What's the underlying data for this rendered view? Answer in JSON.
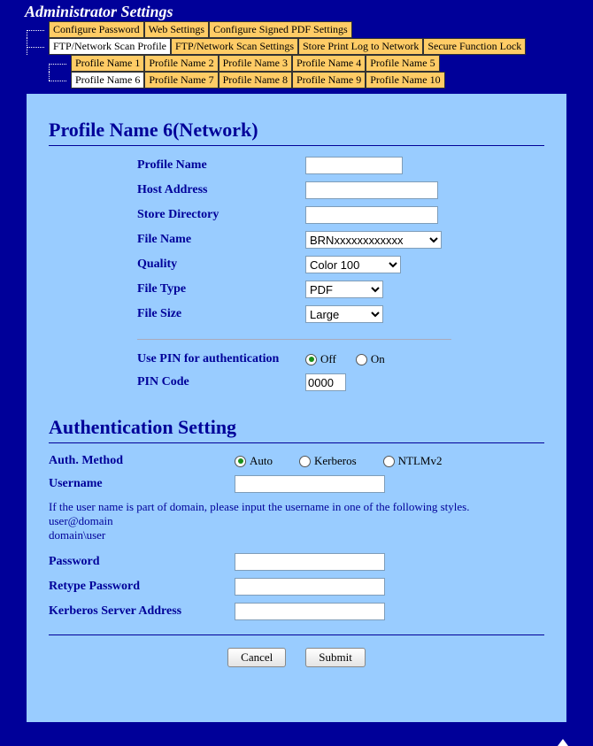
{
  "title": "Administrator Settings",
  "nav": {
    "row1": [
      {
        "label": "Configure Password",
        "active": false
      },
      {
        "label": "Web Settings",
        "active": false
      },
      {
        "label": "Configure Signed PDF Settings",
        "active": false
      }
    ],
    "row2": [
      {
        "label": "FTP/Network Scan Profile",
        "active": true
      },
      {
        "label": "FTP/Network Scan Settings",
        "active": false
      },
      {
        "label": "Store Print Log to Network",
        "active": false
      },
      {
        "label": "Secure Function Lock",
        "active": false
      }
    ],
    "row3": [
      {
        "label": "Profile Name 1",
        "active": false
      },
      {
        "label": "Profile Name 2",
        "active": false
      },
      {
        "label": "Profile Name 3",
        "active": false
      },
      {
        "label": "Profile Name 4",
        "active": false
      },
      {
        "label": "Profile Name 5",
        "active": false
      }
    ],
    "row4": [
      {
        "label": "Profile Name 6",
        "active": true
      },
      {
        "label": "Profile Name 7",
        "active": false
      },
      {
        "label": "Profile Name 8",
        "active": false
      },
      {
        "label": "Profile Name 9",
        "active": false
      },
      {
        "label": "Profile Name 10",
        "active": false
      }
    ]
  },
  "section1": {
    "heading": "Profile Name 6(Network)",
    "labels": {
      "profile_name": "Profile Name",
      "host_address": "Host Address",
      "store_directory": "Store Directory",
      "file_name": "File Name",
      "quality": "Quality",
      "file_type": "File Type",
      "file_size": "File Size",
      "use_pin": "Use PIN for authentication",
      "pin_code": "PIN Code"
    },
    "values": {
      "profile_name": "",
      "host_address": "",
      "store_directory": "",
      "file_name": "BRNxxxxxxxxxxxx",
      "quality": "Color 100",
      "file_type": "PDF",
      "file_size": "Large",
      "pin_off": "Off",
      "pin_on": "On",
      "pin_code": "0000"
    }
  },
  "section2": {
    "heading": "Authentication Setting",
    "labels": {
      "auth_method": "Auth. Method",
      "username": "Username",
      "password": "Password",
      "retype_password": "Retype Password",
      "kerberos": "Kerberos Server Address"
    },
    "methods": {
      "auto": "Auto",
      "kerberos": "Kerberos",
      "ntlm": "NTLMv2"
    },
    "hint": "If the user name is part of domain, please input the username in one of the following styles.",
    "hint_l2": "user@domain",
    "hint_l3": "domain\\user",
    "values": {
      "username": "",
      "password": "",
      "retype": "",
      "kerberos": ""
    }
  },
  "buttons": {
    "cancel": "Cancel",
    "submit": "Submit"
  }
}
